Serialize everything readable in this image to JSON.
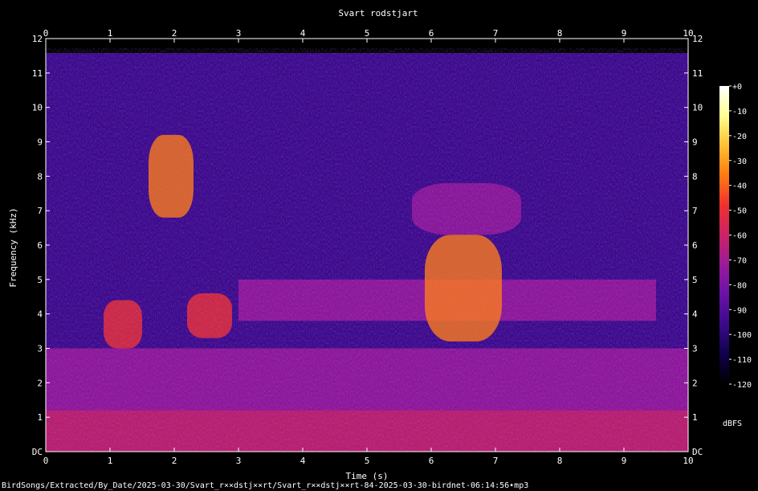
{
  "chart_data": {
    "type": "heatmap",
    "title": "Svart rodstjart",
    "xlabel": "Time (s)",
    "ylabel": "Frequency (kHz)",
    "xlim": [
      0,
      10
    ],
    "ylim": [
      0,
      12
    ],
    "x_ticks": [
      "0",
      "1",
      "2",
      "3",
      "4",
      "5",
      "6",
      "7",
      "8",
      "9",
      "10"
    ],
    "y_ticks": [
      "DC",
      "1",
      "2",
      "3",
      "4",
      "5",
      "6",
      "7",
      "8",
      "9",
      "10",
      "11",
      "12"
    ],
    "colorbar": {
      "label": "dBFS",
      "range": [
        -120,
        0
      ],
      "ticks": [
        "+0",
        "-10",
        "-20",
        "-30",
        "-40",
        "-50",
        "-60",
        "-70",
        "-80",
        "-90",
        "-100",
        "-110",
        "-120"
      ],
      "colors": [
        "#000000",
        "#10004a",
        "#3a0a8a",
        "#6a11a8",
        "#9a1a9a",
        "#cc2266",
        "#f03030",
        "#ff7a10",
        "#ffc030",
        "#ffff90",
        "#ffffff"
      ]
    },
    "energy_regions": [
      {
        "t_start": 1.6,
        "t_end": 2.3,
        "f_low": 6.8,
        "f_high": 9.2,
        "level_dbfs": -35
      },
      {
        "t_start": 0.9,
        "t_end": 1.5,
        "f_low": 3.0,
        "f_high": 4.4,
        "level_dbfs": -50
      },
      {
        "t_start": 2.2,
        "t_end": 2.9,
        "f_low": 3.3,
        "f_high": 4.6,
        "level_dbfs": -45
      },
      {
        "t_start": 5.9,
        "t_end": 7.1,
        "f_low": 3.2,
        "f_high": 6.3,
        "level_dbfs": -40
      },
      {
        "t_start": 5.7,
        "t_end": 7.4,
        "f_low": 6.3,
        "f_high": 7.8,
        "level_dbfs": -75
      },
      {
        "t_start": 0.0,
        "t_end": 10.0,
        "f_low": 0.0,
        "f_high": 1.2,
        "level_dbfs": -55
      },
      {
        "t_start": 0.0,
        "t_end": 10.0,
        "f_low": 1.2,
        "f_high": 3.0,
        "level_dbfs": -75
      },
      {
        "t_start": 3.0,
        "t_end": 9.5,
        "f_low": 3.8,
        "f_high": 5.0,
        "level_dbfs": -75
      }
    ],
    "background_level_dbfs": -92
  },
  "footer": {
    "filename": "BirdSongs/Extracted/By_Date/2025-03-30/Svart_r××dstj××rt/Svart_r××dstj××rt-84-2025-03-30-birdnet-06:14:56•mp3"
  }
}
